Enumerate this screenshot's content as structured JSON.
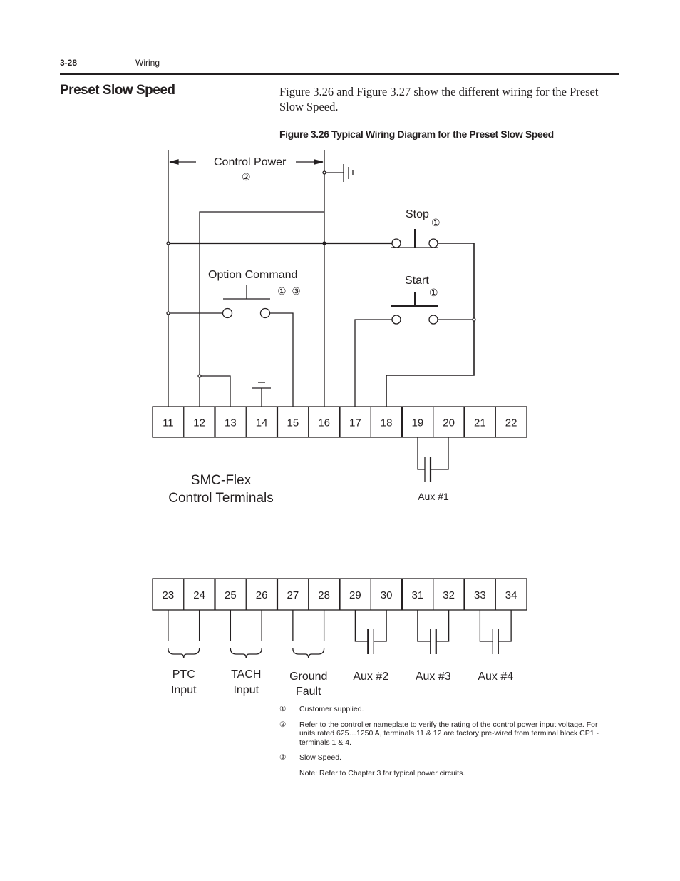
{
  "header": {
    "page_number": "3-28",
    "running_head": "Wiring"
  },
  "section": {
    "title": "Preset Slow Speed",
    "intro": "Figure 3.26 and Figure 3.27 show the different wiring for the Preset Slow Speed."
  },
  "figure": {
    "caption": "Figure 3.26 Typical Wiring Diagram for the Preset Slow Speed",
    "labels": {
      "control_power": "Control Power",
      "control_power_note": "②",
      "stop": "Stop",
      "stop_note": "①",
      "start": "Start",
      "start_note": "①",
      "option_command": "Option Command",
      "option_command_notes": "①  ③",
      "smc_line1": "SMC-Flex",
      "smc_line2": "Control Terminals",
      "aux1": "Aux #1"
    },
    "terminals_top": [
      "11",
      "12",
      "13",
      "14",
      "15",
      "16",
      "17",
      "18",
      "19",
      "20",
      "21",
      "22"
    ],
    "terminals_bottom": [
      "23",
      "24",
      "25",
      "26",
      "27",
      "28",
      "29",
      "30",
      "31",
      "32",
      "33",
      "34"
    ],
    "bottom_groups": [
      {
        "line1": "PTC",
        "line2": "Input"
      },
      {
        "line1": "TACH",
        "line2": "Input"
      },
      {
        "line1": "Ground",
        "line2": "Fault"
      },
      {
        "line1": "Aux #2",
        "line2": ""
      },
      {
        "line1": "Aux #3",
        "line2": ""
      },
      {
        "line1": "Aux #4",
        "line2": ""
      }
    ]
  },
  "notes": [
    {
      "marker": "①",
      "text": "Customer supplied."
    },
    {
      "marker": "②",
      "text": "Refer to the controller nameplate to verify the rating of the control power input voltage. For units rated 625…1250 A, terminals 11 & 12 are factory pre-wired from terminal block CP1 - terminals 1 & 4."
    },
    {
      "marker": "③",
      "text": "Slow Speed."
    }
  ],
  "final_note": "Note: Refer to Chapter 3 for typical power circuits."
}
